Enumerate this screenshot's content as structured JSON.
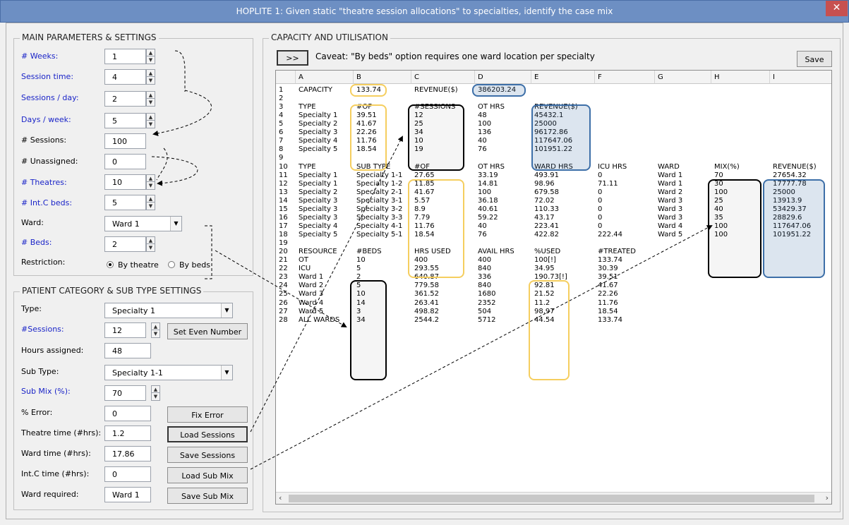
{
  "window": {
    "title": "HOPLITE 1: Given static \"theatre session allocations\" to specialties, identify the case mix",
    "close": "✕"
  },
  "main_params": {
    "legend": "MAIN PARAMETERS & SETTINGS",
    "weeks_label": "# Weeks:",
    "weeks": "1",
    "session_time_label": "Session time:",
    "session_time": "4",
    "sessions_day_label": "Sessions / day:",
    "sessions_day": "2",
    "days_week_label": "Days / week:",
    "days_week": "5",
    "sessions_label": "# Sessions:",
    "sessions": "100",
    "unassigned_label": "# Unassigned:",
    "unassigned": "0",
    "theatres_label": "# Theatres:",
    "theatres": "10",
    "intc_beds_label": "# Int.C beds:",
    "intc_beds": "5",
    "ward_label": "Ward:",
    "ward": "Ward 1",
    "beds_label": "# Beds:",
    "beds": "2",
    "restriction_label": "Restriction:",
    "by_theatre": "By theatre",
    "by_beds": "By beds"
  },
  "patient": {
    "legend": "PATIENT CATEGORY & SUB TYPE SETTINGS",
    "type_label": "Type:",
    "type": "Specialty 1",
    "sessions_label": "#Sessions:",
    "sessions": "12",
    "set_even": "Set Even Number",
    "hours_label": "Hours assigned:",
    "hours": "48",
    "subtype_label": "Sub Type:",
    "subtype": "Specialty 1-1",
    "submix_label": "Sub Mix (%):",
    "submix": "70",
    "error_label": "% Error:",
    "error": "0",
    "fix_error": "Fix Error",
    "theatre_time_label": "Theatre time (#hrs):",
    "theatre_time": "1.2",
    "load_sessions": "Load Sessions",
    "ward_time_label": "Ward time (#hrs):",
    "ward_time": "17.86",
    "save_sessions": "Save Sessions",
    "intc_time_label": "Int.C time (#hrs):",
    "intc_time": "0",
    "load_submix": "Load Sub Mix",
    "ward_req_label": "Ward required:",
    "ward_req": "Ward 1",
    "save_submix": "Save Sub Mix"
  },
  "capacity": {
    "legend": "CAPACITY AND UTILISATION",
    "expand": ">>",
    "caveat": "Caveat: \"By beds\" option requires one ward location per specialty",
    "save": "Save"
  },
  "sheet": {
    "columns": [
      "A",
      "B",
      "C",
      "D",
      "E",
      "F",
      "G",
      "H",
      "I"
    ],
    "rows": [
      [
        "1",
        "CAPACITY",
        "133.74",
        "REVENUE($)",
        "386203.24",
        "",
        "",
        "",
        "",
        ""
      ],
      [
        "2",
        "",
        "",
        "",
        "",
        "",
        "",
        "",
        "",
        ""
      ],
      [
        "3",
        "TYPE",
        "#OF",
        "#SESSIONS",
        "OT HRS",
        "REVENUE($)",
        "",
        "",
        "",
        ""
      ],
      [
        "4",
        "Specialty 1",
        "39.51",
        "12",
        "48",
        "45432.1",
        "",
        "",
        "",
        ""
      ],
      [
        "5",
        "Specialty 2",
        "41.67",
        "25",
        "100",
        "25000",
        "",
        "",
        "",
        ""
      ],
      [
        "6",
        "Specialty 3",
        "22.26",
        "34",
        "136",
        "96172.86",
        "",
        "",
        "",
        ""
      ],
      [
        "7",
        "Specialty 4",
        "11.76",
        "10",
        "40",
        "117647.06",
        "",
        "",
        "",
        ""
      ],
      [
        "8",
        "Specialty 5",
        "18.54",
        "19",
        "76",
        "101951.22",
        "",
        "",
        "",
        ""
      ],
      [
        "9",
        "",
        "",
        "",
        "",
        "",
        "",
        "",
        "",
        ""
      ],
      [
        "10",
        "TYPE",
        "SUB TYPE",
        "#OF",
        "OT HRS",
        "WARD HRS",
        "ICU HRS",
        "WARD",
        "MIX(%)",
        "REVENUE($)"
      ],
      [
        "11",
        "Specialty 1",
        "Specialty 1-1",
        "27.65",
        "33.19",
        "493.91",
        "0",
        "Ward 1",
        "70",
        "27654.32"
      ],
      [
        "12",
        "Specialty 1",
        "Specialty 1-2",
        "11.85",
        "14.81",
        "98.96",
        "71.11",
        "Ward 1",
        "30",
        "17777.78"
      ],
      [
        "13",
        "Specialty 2",
        "Specialty 2-1",
        "41.67",
        "100",
        "679.58",
        "0",
        "Ward 2",
        "100",
        "25000"
      ],
      [
        "14",
        "Specialty 3",
        "Specialty 3-1",
        "5.57",
        "36.18",
        "72.02",
        "0",
        "Ward 3",
        "25",
        "13913.9"
      ],
      [
        "15",
        "Specialty 3",
        "Specialty 3-2",
        "8.9",
        "40.61",
        "110.33",
        "0",
        "Ward 3",
        "40",
        "53429.37"
      ],
      [
        "16",
        "Specialty 3",
        "Specialty 3-3",
        "7.79",
        "59.22",
        "43.17",
        "0",
        "Ward 3",
        "35",
        "28829.6"
      ],
      [
        "17",
        "Specialty 4",
        "Specialty 4-1",
        "11.76",
        "40",
        "223.41",
        "0",
        "Ward 4",
        "100",
        "117647.06"
      ],
      [
        "18",
        "Specialty 5",
        "Specialty 5-1",
        "18.54",
        "76",
        "422.82",
        "222.44",
        "Ward 5",
        "100",
        "101951.22"
      ],
      [
        "19",
        "",
        "",
        "",
        "",
        "",
        "",
        "",
        "",
        ""
      ],
      [
        "20",
        "RESOURCE",
        "#BEDS",
        "HRS USED",
        "AVAIL HRS",
        "%USED",
        "#TREATED",
        "",
        "",
        ""
      ],
      [
        "21",
        "OT",
        "10",
        "400",
        "400",
        "100[!]",
        "133.74",
        "",
        "",
        ""
      ],
      [
        "22",
        "ICU",
        "5",
        "293.55",
        "840",
        "34.95",
        "30.39",
        "",
        "",
        ""
      ],
      [
        "23",
        "Ward 1",
        "2",
        "640.87",
        "336",
        "190.73[!]",
        "39.51",
        "",
        "",
        ""
      ],
      [
        "24",
        "Ward 2",
        "5",
        "779.58",
        "840",
        "92.81",
        "41.67",
        "",
        "",
        ""
      ],
      [
        "25",
        "Ward 3",
        "10",
        "361.52",
        "1680",
        "21.52",
        "22.26",
        "",
        "",
        ""
      ],
      [
        "26",
        "Ward 4",
        "14",
        "263.41",
        "2352",
        "11.2",
        "11.76",
        "",
        "",
        ""
      ],
      [
        "27",
        "Ward 5",
        "3",
        "498.82",
        "504",
        "98.97",
        "18.54",
        "",
        "",
        ""
      ],
      [
        "28",
        "ALL WARDS",
        "34",
        "2544.2",
        "5712",
        "44.54",
        "133.74",
        "",
        "",
        ""
      ]
    ]
  }
}
